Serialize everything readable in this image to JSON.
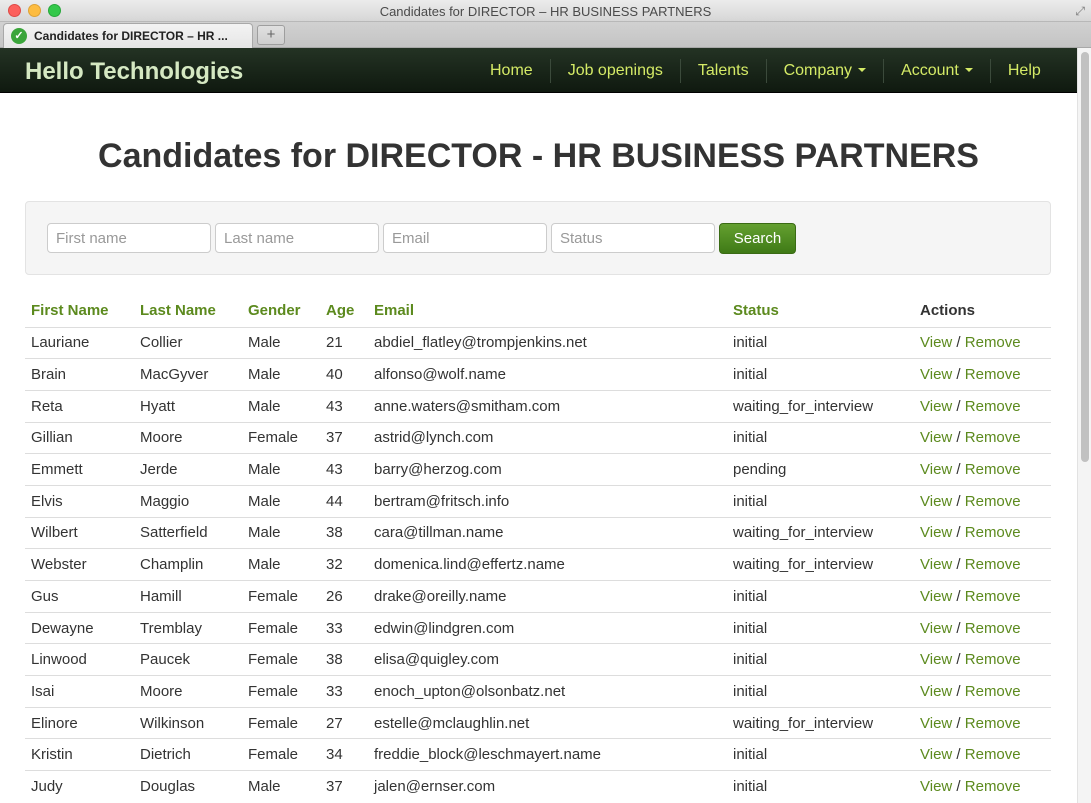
{
  "window": {
    "title": "Candidates for DIRECTOR – HR BUSINESS PARTNERS",
    "tab_label": "Candidates for DIRECTOR – HR ...",
    "new_tab_symbol": "+"
  },
  "navbar": {
    "brand": "Hello Technologies",
    "items": [
      {
        "label": "Home"
      },
      {
        "label": "Job openings"
      },
      {
        "label": "Talents"
      },
      {
        "label": "Company"
      },
      {
        "label": "Account"
      },
      {
        "label": "Help"
      }
    ]
  },
  "page": {
    "title": "Candidates for DIRECTOR - HR BUSINESS PARTNERS"
  },
  "search": {
    "first_name_placeholder": "First name",
    "last_name_placeholder": "Last name",
    "email_placeholder": "Email",
    "status_placeholder": "Status",
    "button_label": "Search"
  },
  "table": {
    "headers": {
      "first_name": "First Name",
      "last_name": "Last Name",
      "gender": "Gender",
      "age": "Age",
      "email": "Email",
      "status": "Status",
      "actions": "Actions"
    },
    "view_label": "View",
    "separator": "/",
    "remove_label": "Remove",
    "rows": [
      {
        "first": "Lauriane",
        "last": "Collier",
        "gender": "Male",
        "age": "21",
        "email": "abdiel_flatley@trompjenkins.net",
        "status": "initial"
      },
      {
        "first": "Brain",
        "last": "MacGyver",
        "gender": "Male",
        "age": "40",
        "email": "alfonso@wolf.name",
        "status": "initial"
      },
      {
        "first": "Reta",
        "last": "Hyatt",
        "gender": "Male",
        "age": "43",
        "email": "anne.waters@smitham.com",
        "status": "waiting_for_interview"
      },
      {
        "first": "Gillian",
        "last": "Moore",
        "gender": "Female",
        "age": "37",
        "email": "astrid@lynch.com",
        "status": "initial"
      },
      {
        "first": "Emmett",
        "last": "Jerde",
        "gender": "Male",
        "age": "43",
        "email": "barry@herzog.com",
        "status": "pending"
      },
      {
        "first": "Elvis",
        "last": "Maggio",
        "gender": "Male",
        "age": "44",
        "email": "bertram@fritsch.info",
        "status": "initial"
      },
      {
        "first": "Wilbert",
        "last": "Satterfield",
        "gender": "Male",
        "age": "38",
        "email": "cara@tillman.name",
        "status": "waiting_for_interview"
      },
      {
        "first": "Webster",
        "last": "Champlin",
        "gender": "Male",
        "age": "32",
        "email": "domenica.lind@effertz.name",
        "status": "waiting_for_interview"
      },
      {
        "first": "Gus",
        "last": "Hamill",
        "gender": "Female",
        "age": "26",
        "email": "drake@oreilly.name",
        "status": "initial"
      },
      {
        "first": "Dewayne",
        "last": "Tremblay",
        "gender": "Female",
        "age": "33",
        "email": "edwin@lindgren.com",
        "status": "initial"
      },
      {
        "first": "Linwood",
        "last": "Paucek",
        "gender": "Female",
        "age": "38",
        "email": "elisa@quigley.com",
        "status": "initial"
      },
      {
        "first": "Isai",
        "last": "Moore",
        "gender": "Female",
        "age": "33",
        "email": "enoch_upton@olsonbatz.net",
        "status": "initial"
      },
      {
        "first": "Elinore",
        "last": "Wilkinson",
        "gender": "Female",
        "age": "27",
        "email": "estelle@mclaughlin.net",
        "status": "waiting_for_interview"
      },
      {
        "first": "Kristin",
        "last": "Dietrich",
        "gender": "Female",
        "age": "34",
        "email": "freddie_block@leschmayert.name",
        "status": "initial"
      },
      {
        "first": "Judy",
        "last": "Douglas",
        "gender": "Male",
        "age": "37",
        "email": "jalen@ernser.com",
        "status": "initial"
      }
    ]
  }
}
